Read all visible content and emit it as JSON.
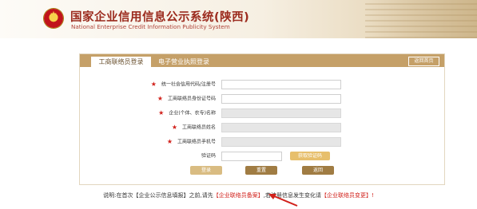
{
  "header": {
    "title_cn": "国家企业信用信息公示系统(陕西)",
    "title_en": "National Enterprise Credit Information Publicity System"
  },
  "tabs": {
    "active": "工商联络员登录",
    "second": "电子营业执照登录",
    "back_home": "返回首页"
  },
  "form": {
    "fields": [
      {
        "label": "统一社会信用代码/注册号",
        "required": true,
        "value": "",
        "disabled": false
      },
      {
        "label": "工商联络员身份证号码",
        "required": true,
        "value": "",
        "disabled": false
      },
      {
        "label": "企业(个体、农专)名称",
        "required": true,
        "value": "",
        "disabled": true
      },
      {
        "label": "工商联络员姓名",
        "required": true,
        "value": "",
        "disabled": true
      },
      {
        "label": "工商联络员手机号",
        "required": true,
        "value": "",
        "disabled": true
      }
    ],
    "captcha_label": "验证码",
    "captcha_value": "",
    "get_code": "获取验证码",
    "login": "登录",
    "reset": "重置",
    "back": "返回"
  },
  "note": {
    "prefix": "说明:在首次【企业公示信息填报】之前,请先",
    "link1": "【企业联络员备案】",
    "middle": ",若注册信息发生变化请",
    "link2": "【企业联络员变更】",
    "suffix": "!"
  },
  "colors": {
    "accent": "#c5a068",
    "title": "#9b2a1d",
    "required": "#d1211b"
  }
}
